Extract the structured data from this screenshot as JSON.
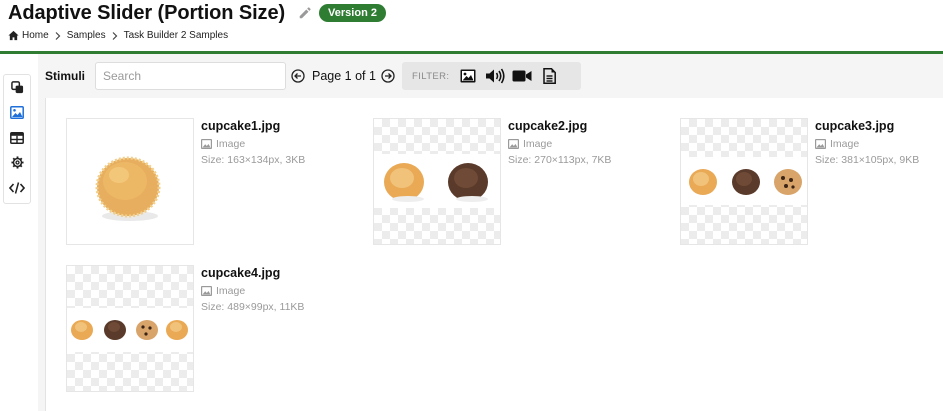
{
  "header": {
    "title": "Adaptive Slider (Portion Size)",
    "version_badge": "Version 2",
    "breadcrumbs": [
      "Home",
      "Samples",
      "Task Builder 2 Samples"
    ],
    "accent_color": "#2e7d32"
  },
  "sidebar": {
    "items": [
      {
        "icon": "copy-icon",
        "active": false
      },
      {
        "icon": "image-icon",
        "active": true
      },
      {
        "icon": "table-icon",
        "active": false
      },
      {
        "icon": "gear-icon",
        "active": false
      },
      {
        "icon": "code-icon",
        "active": false
      }
    ]
  },
  "toolbar": {
    "section_label": "Stimuli",
    "search_placeholder": "Search",
    "search_value": "",
    "pager_text": "Page 1 of 1",
    "filter_label": "FILTER:",
    "filters": [
      "image-icon",
      "audio-icon",
      "video-icon",
      "document-icon"
    ]
  },
  "files": [
    {
      "name": "cupcake1.jpg",
      "type": "Image",
      "size": "Size: 163×134px, 3KB"
    },
    {
      "name": "cupcake2.jpg",
      "type": "Image",
      "size": "Size: 270×113px, 7KB"
    },
    {
      "name": "cupcake3.jpg",
      "type": "Image",
      "size": "Size: 381×105px, 9KB"
    },
    {
      "name": "cupcake4.jpg",
      "type": "Image",
      "size": "Size: 489×99px, 11KB"
    }
  ]
}
